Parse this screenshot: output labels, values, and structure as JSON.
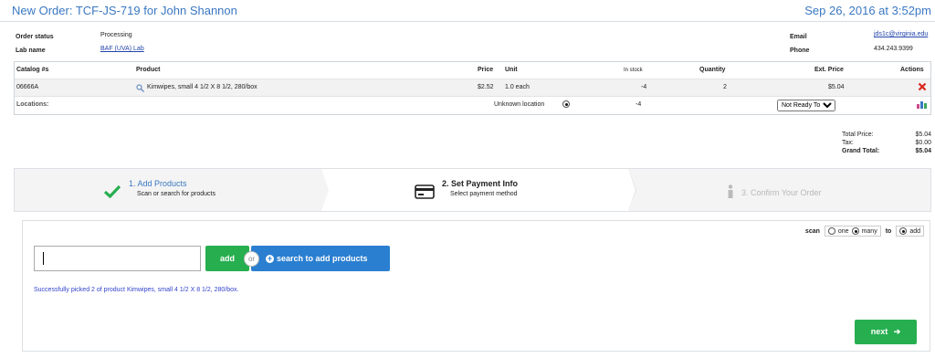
{
  "order": {
    "title": "New Order: TCF-JS-719 for John Shannon",
    "date": "Sep 26, 2016 at 3:52pm",
    "status_label": "Order status",
    "status": "Processing",
    "lab_label": "Lab name",
    "lab": "BAF (UVA) Lab",
    "email_label": "Email",
    "email": "jds1c@virginia.edu",
    "phone_label": "Phone",
    "phone": "434.243.9399"
  },
  "table": {
    "headers": {
      "catalog": "Catalog #s",
      "product": "Product",
      "price": "Price",
      "unit": "Unit",
      "stock": "In stock",
      "quantity": "Quantity",
      "ext_price": "Ext. Price",
      "actions": "Actions"
    },
    "row": {
      "catalog": "06666A",
      "product": "Kimwipes, small 4 1/2 X 8 1/2, 280/box",
      "price": "$2.52",
      "unit": "1.0 each",
      "stock": "-4",
      "quantity": "2",
      "ext_price": "$5.04"
    },
    "locations": {
      "label": "Locations:",
      "location": "Unknown location",
      "stock": "-4",
      "select_value": "Not Ready To",
      "select_options": [
        "Not Ready To"
      ]
    }
  },
  "totals": {
    "total_label": "Total Price:",
    "total": "$5.04",
    "tax_label": "Tax:",
    "tax": "$0.00",
    "grand_label": "Grand Total:",
    "grand": "$5.04"
  },
  "steps": [
    {
      "title": "1. Add Products",
      "subtitle": "Scan or search for products",
      "icon": "check-icon"
    },
    {
      "title": "2. Set Payment Info",
      "subtitle": "Select payment method",
      "icon": "credit-card-icon"
    },
    {
      "title": "3. Confirm Your Order",
      "subtitle": "",
      "icon": "info-icon"
    }
  ],
  "scan": {
    "label": "scan",
    "opt_one": "one",
    "opt_many": "many",
    "to_label": "to",
    "opt_add": "add"
  },
  "entry": {
    "input_value": "",
    "add_label": "add",
    "or_label": "or",
    "search_label": "search to add products",
    "message": "Successfully picked 2 of product Kimwipes, small 4 1/2 X 8 1/2, 280/box.",
    "next_label": "next"
  },
  "colors": {
    "accent": "#3a78c2",
    "green": "#27ae4f",
    "blue_button": "#2a7fd0",
    "delete": "#d9261c"
  }
}
